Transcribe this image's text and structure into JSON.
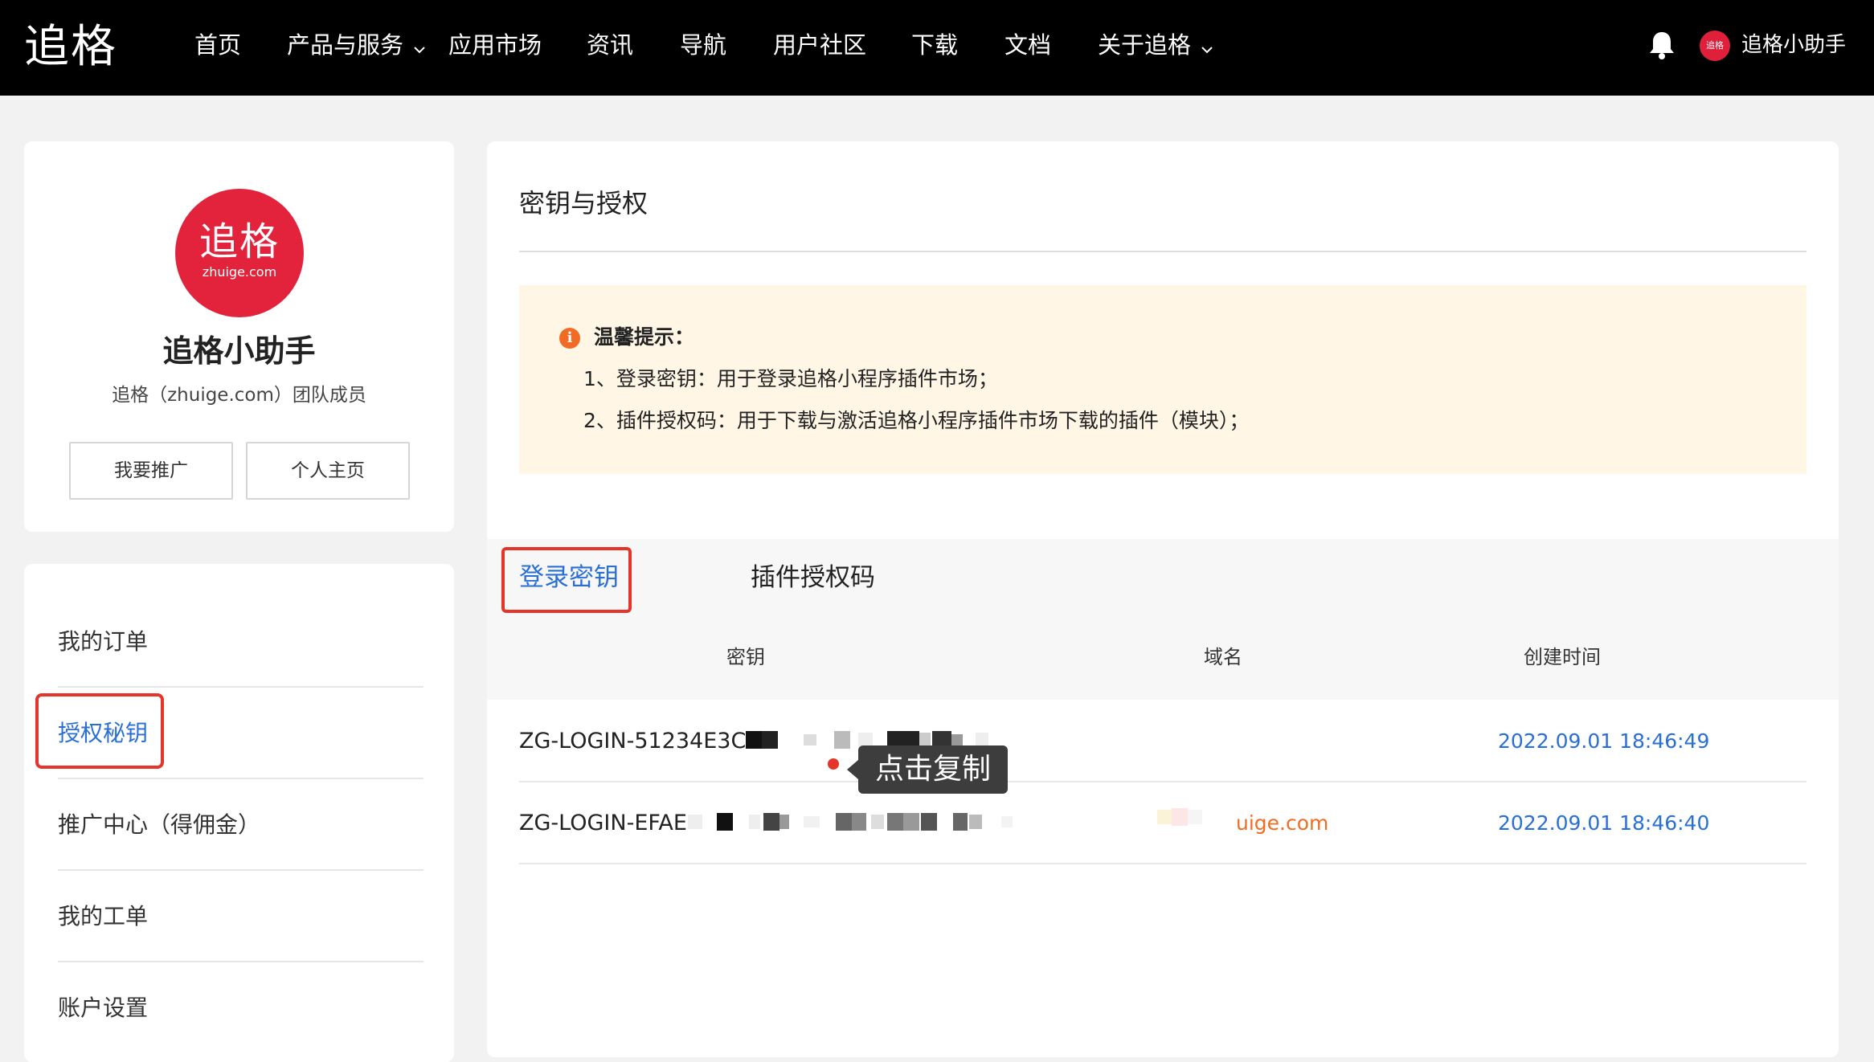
{
  "topnav": {
    "logo": "追格",
    "items": [
      "首页",
      "产品与服务",
      "应用市场",
      "资讯",
      "导航",
      "用户社区",
      "下载",
      "文档",
      "关于追格"
    ],
    "avatar_text": "追格",
    "username": "追格小助手"
  },
  "profile": {
    "logo_cn": "追格",
    "logo_en": "zhuige.com",
    "name": "追格小助手",
    "subtitle": "追格（zhuige.com）团队成员",
    "promote_label": "我要推广",
    "homepage_label": "个人主页"
  },
  "sidebar": {
    "items": [
      {
        "label": "我的订单"
      },
      {
        "label": "授权秘钥",
        "active": true
      },
      {
        "label": "推广中心（得佣金）"
      },
      {
        "label": "我的工单"
      },
      {
        "label": "账户设置"
      }
    ]
  },
  "main": {
    "title": "密钥与授权",
    "notice": {
      "title": "温馨提示：",
      "lines": [
        "1、登录密钥：用于登录追格小程序插件市场；",
        "2、插件授权码：用于下载与激活追格小程序插件市场下载的插件（模块）；"
      ]
    },
    "tabs": [
      {
        "label": "登录密钥",
        "active": true
      },
      {
        "label": "插件授权码"
      }
    ],
    "table": {
      "headers": [
        "密钥",
        "域名",
        "创建时间"
      ],
      "rows": [
        {
          "key": "ZG-LOGIN-51234E3C-1",
          "domain": "",
          "time": "2022.09.01 18:46:49"
        },
        {
          "key": "ZG-LOGIN-EFAE",
          "domain": "uige.com",
          "time": "2022.09.01 18:46:40"
        }
      ]
    },
    "tooltip": "点击复制"
  },
  "colors": {
    "accent_blue": "#2a6fd6",
    "brand_red": "#e3233b",
    "highlight_red": "#e5352b",
    "domain_orange": "#f26b24",
    "notice_bg": "#fff6e6"
  }
}
